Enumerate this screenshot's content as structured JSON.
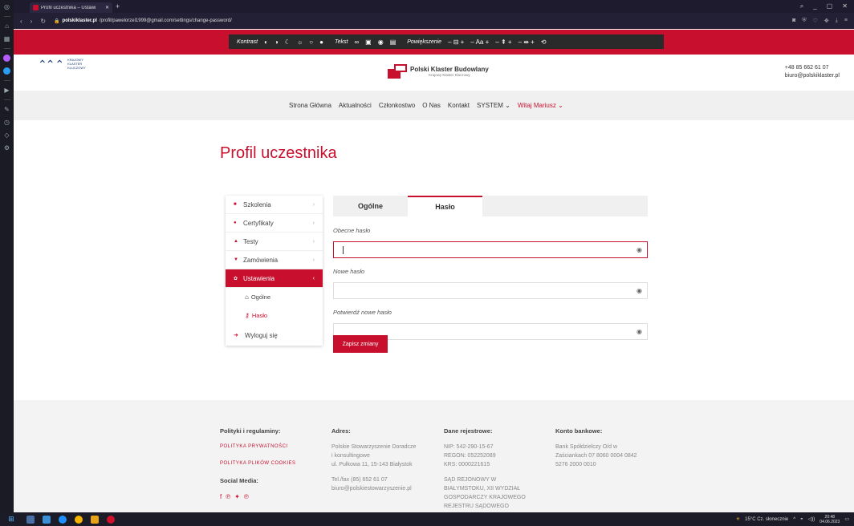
{
  "browser": {
    "tab_title": "Profil uczestnika – Ustawi",
    "url_domain": "polskiklaster.pl",
    "url_path": "/profil/pawelorzel1999@gmail.com/settings/change-password/"
  },
  "a11y": {
    "contrast_label": "Kontrast",
    "text_label": "Tekst",
    "zoom_label": "Powiększenie"
  },
  "header": {
    "left_logo_text": [
      "Krajowy",
      "Klaster",
      "Kluczowy"
    ],
    "center_logo_title": "Polski Klaster Budowlany",
    "center_logo_sub": "Krajowy Klaster Kluczowy",
    "phone": "+48 85 662 61 07",
    "email": "biuro@polskiklaster.pl"
  },
  "nav": {
    "items": [
      "Strona Główna",
      "Aktualności",
      "Członkostwo",
      "O Nas",
      "Kontakt",
      "SYSTEM ⌄"
    ],
    "user": "Witaj Mariusz ⌄"
  },
  "page": {
    "title": "Profil uczestnika"
  },
  "sidemenu": {
    "items": [
      {
        "label": "Szkolenia"
      },
      {
        "label": "Certyfikaty"
      },
      {
        "label": "Testy"
      },
      {
        "label": "Zamówienia"
      },
      {
        "label": "Ustawienia"
      }
    ],
    "sub": [
      {
        "label": "Ogólne"
      },
      {
        "label": "Hasło"
      }
    ],
    "logout": "Wyloguj się"
  },
  "tabs": {
    "general": "Ogólne",
    "password": "Hasło"
  },
  "form": {
    "current_label": "Obecne hasło",
    "new_label": "Nowe hasło",
    "confirm_label": "Potwierdź nowe hasło",
    "save": "Zapisz zmiany"
  },
  "footer": {
    "policies_title": "Polityki i regulaminy:",
    "privacy": "Polityka prywatności",
    "cookies": "Polityka plików cookies",
    "social_title": "Social Media:",
    "address_title": "Adres:",
    "address_lines": [
      "Polskie Stowarzyszenie Doradcze",
      "i konsultingowe",
      "ul. Pułkowa 11, 15-143 Białystok"
    ],
    "address_contact": [
      "Tel./fax (85) 652 61 07",
      "biuro@polskiestowarzyszenie.pl"
    ],
    "registry_title": "Dane rejestrowe:",
    "registry_lines": [
      "NIP: 542-290-15-67",
      "REGON: 052252089",
      "KRS: 0000221615"
    ],
    "registry_court": [
      "SĄD REJONOWY W",
      "BIAŁYMSTOKU, XII WYDZIAŁ",
      "GOSPODARCZY KRAJOWEGO",
      "REJESTRU SĄDOWEGO"
    ],
    "bank_title": "Konto bankowe:",
    "bank_lines": [
      "Bank Spółdzielczy O/d w",
      "Zaściankach 07 8060 0004 0842",
      "5276 2000 0010"
    ]
  },
  "taskbar": {
    "weather": "15°C Cz. słonecznie",
    "time": "20:48",
    "date": "04.06.2023"
  }
}
